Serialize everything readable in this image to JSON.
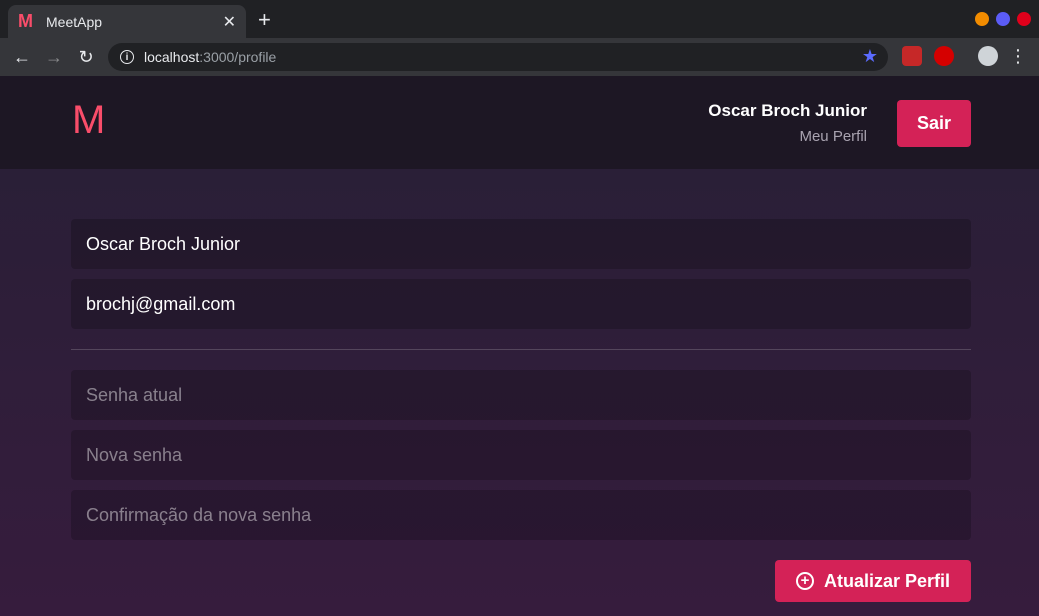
{
  "browser": {
    "tab_title": "MeetApp",
    "tab_favicon": "M",
    "tab_close": "✕",
    "new_tab": "+",
    "url_host": "localhost",
    "url_rest": ":3000/profile",
    "window_dot_colors": [
      "#f28c00",
      "#5b5cf6",
      "#e0001b"
    ]
  },
  "header": {
    "logo": "M",
    "user_name": "Oscar Broch Junior",
    "profile_link": "Meu Perfil",
    "logout_label": "Sair"
  },
  "form": {
    "name_value": "Oscar Broch Junior",
    "email_value": "brochj@gmail.com",
    "old_password_placeholder": "Senha atual",
    "new_password_placeholder": "Nova senha",
    "confirm_password_placeholder": "Confirmação da nova senha",
    "submit_label": "Atualizar Perfil"
  },
  "colors": {
    "accent": "#f94d6a",
    "button": "#d42257",
    "header_bg": "#1d1724"
  }
}
